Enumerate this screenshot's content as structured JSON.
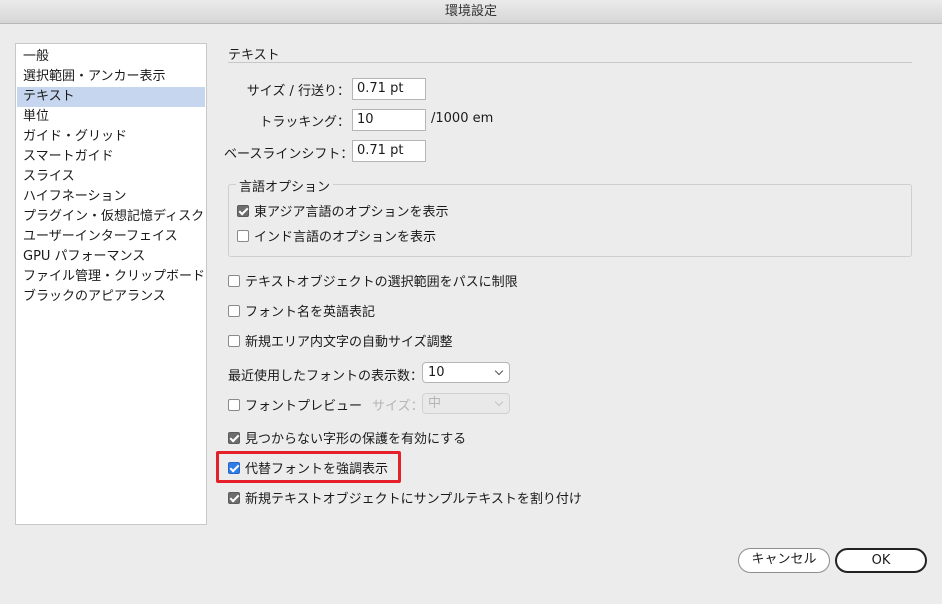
{
  "window": {
    "title": "環境設定"
  },
  "sidebar": {
    "items": [
      {
        "label": "一般"
      },
      {
        "label": "選択範囲・アンカー表示"
      },
      {
        "label": "テキスト",
        "selected": true
      },
      {
        "label": "単位"
      },
      {
        "label": "ガイド・グリッド"
      },
      {
        "label": "スマートガイド"
      },
      {
        "label": "スライス"
      },
      {
        "label": "ハイフネーション"
      },
      {
        "label": "プラグイン・仮想記憶ディスク"
      },
      {
        "label": "ユーザーインターフェイス"
      },
      {
        "label": "GPU パフォーマンス"
      },
      {
        "label": "ファイル管理・クリップボード"
      },
      {
        "label": "ブラックのアピアランス"
      }
    ]
  },
  "main": {
    "section_title": "テキスト",
    "size_leading": {
      "label": "サイズ / 行送り：",
      "value": "0.71 pt"
    },
    "tracking": {
      "label": "トラッキング：",
      "value": "10",
      "unit": "/1000 em"
    },
    "baseline_shift": {
      "label": "ベースラインシフト：",
      "value": "0.71 pt"
    },
    "language_options": {
      "title": "言語オプション",
      "east_asian": {
        "label": "東アジア言語のオプションを表示",
        "checked": true
      },
      "indic": {
        "label": "インド言語のオプションを表示",
        "checked": false
      }
    },
    "limit_selection_to_path": {
      "label": "テキストオブジェクトの選択範囲をパスに制限",
      "checked": false
    },
    "font_names_english": {
      "label": "フォント名を英語表記",
      "checked": false
    },
    "auto_size_area_type": {
      "label": "新規エリア内文字の自動サイズ調整",
      "checked": false
    },
    "recent_fonts": {
      "label": "最近使用したフォントの表示数：",
      "value": "10"
    },
    "font_preview": {
      "label": "フォントプレビュー",
      "checked": false,
      "size_label": "サイズ：",
      "size_value": "中"
    },
    "missing_glyph_protection": {
      "label": "見つからない字形の保護を有効にする",
      "checked": true
    },
    "highlight_substituted_fonts": {
      "label": "代替フォントを強調表示",
      "checked": true
    },
    "fill_placeholder_text": {
      "label": "新規テキストオブジェクトにサンプルテキストを割り付け",
      "checked": true
    }
  },
  "buttons": {
    "cancel": "キャンセル",
    "ok": "OK"
  },
  "colors": {
    "selection": "#c5d6ee",
    "highlight_box": "#e6202a",
    "checkbox_accent": "#2f7be8"
  }
}
